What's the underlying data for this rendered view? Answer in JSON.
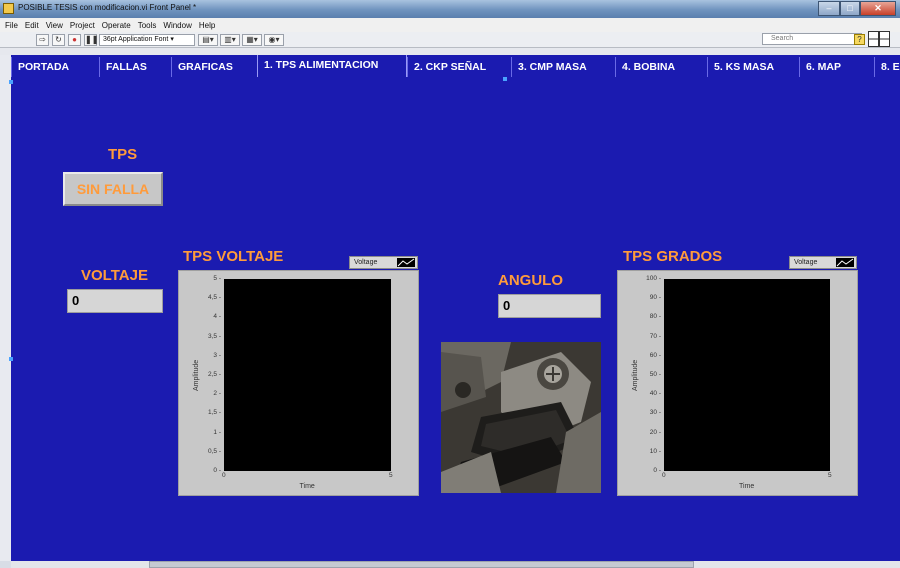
{
  "window": {
    "title": "POSIBLE TESIS con modificacion.vi Front Panel *"
  },
  "menu": [
    "File",
    "Edit",
    "View",
    "Project",
    "Operate",
    "Tools",
    "Window",
    "Help"
  ],
  "toolbar": {
    "font": "36pt Application Font",
    "search_placeholder": "Search",
    "help": "?"
  },
  "tabs": [
    "PORTADA",
    "FALLAS",
    "GRAFICAS",
    "1. TPS ALIMENTACION",
    "2. CKP SEÑAL",
    "3. CMP MASA",
    "4. BOBINA",
    "5. KS MASA",
    "6. MAP",
    "8. E"
  ],
  "active_tab": "1. TPS ALIMENTACION",
  "tps": {
    "label": "TPS",
    "status": "SIN FALLA"
  },
  "voltaje": {
    "label": "VOLTAJE",
    "value": "0"
  },
  "angulo": {
    "label": "ANGULO",
    "value": "0"
  },
  "colors": {
    "panel": "#1b1bb0",
    "label": "#ff9b3b",
    "plot": "#000000"
  },
  "graphs": {
    "voltaje": {
      "title": "TPS VOLTAJE",
      "legend": "Voltage",
      "xlabel": "Time",
      "ylabel": "Amplitude",
      "yticks": [
        "5",
        "4,5",
        "4",
        "3,5",
        "3",
        "2,5",
        "2",
        "1,5",
        "1",
        "0,5",
        "0"
      ],
      "xticks": [
        "0",
        "5"
      ]
    },
    "grados": {
      "title": "TPS GRADOS",
      "legend": "Voltage",
      "xlabel": "Time",
      "ylabel": "Amplitude",
      "yticks": [
        "100",
        "90",
        "80",
        "70",
        "60",
        "50",
        "40",
        "30",
        "20",
        "10",
        "0"
      ],
      "xticks": [
        "0",
        "5"
      ]
    }
  },
  "chart_data": [
    {
      "type": "line",
      "title": "TPS VOLTAJE",
      "xlabel": "Time",
      "ylabel": "Amplitude",
      "xlim": [
        0,
        5
      ],
      "ylim": [
        0,
        5
      ],
      "series": [
        {
          "name": "Voltage",
          "values": []
        }
      ],
      "legend": "top-right",
      "grid": false
    },
    {
      "type": "line",
      "title": "TPS GRADOS",
      "xlabel": "Time",
      "ylabel": "Amplitude",
      "xlim": [
        0,
        5
      ],
      "ylim": [
        0,
        100
      ],
      "series": [
        {
          "name": "Voltage",
          "values": []
        }
      ],
      "legend": "top-right",
      "grid": false
    }
  ]
}
